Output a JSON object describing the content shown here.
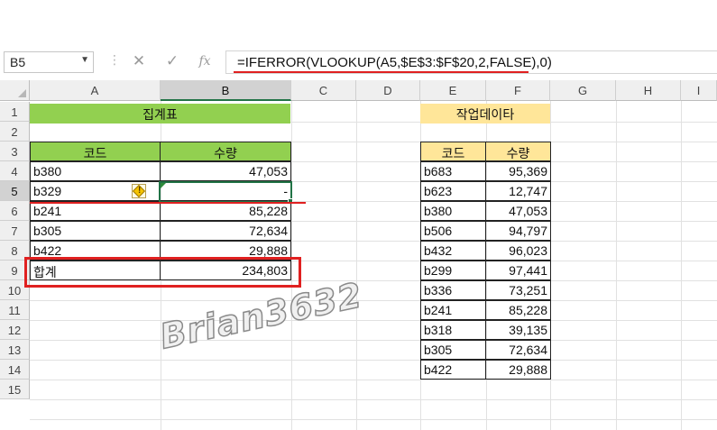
{
  "formula_bar": {
    "name_box": "B5",
    "cancel_icon": "✕",
    "enter_icon": "✓",
    "fx_label": "fx",
    "formula": "=IFERROR(VLOOKUP(A5,$E$3:$F$20,2,FALSE),0)"
  },
  "columns": [
    "A",
    "B",
    "C",
    "D",
    "E",
    "F",
    "G",
    "H",
    "I"
  ],
  "rows": [
    "1",
    "2",
    "3",
    "4",
    "5",
    "6",
    "7",
    "8",
    "9",
    "10",
    "11",
    "12",
    "13",
    "14",
    "15"
  ],
  "summary": {
    "title": "집계표",
    "header_code": "코드",
    "header_qty": "수량",
    "items": [
      {
        "code": "b380",
        "qty": "47,053"
      },
      {
        "code": "b329",
        "qty": "-"
      },
      {
        "code": "b241",
        "qty": "85,228"
      },
      {
        "code": "b305",
        "qty": "72,634"
      },
      {
        "code": "b422",
        "qty": "29,888"
      }
    ],
    "total_label": "합계",
    "total_value": "234,803"
  },
  "work_data": {
    "title": "작업데이타",
    "header_code": "코드",
    "header_qty": "수량",
    "items": [
      {
        "code": "b683",
        "qty": "95,369"
      },
      {
        "code": "b623",
        "qty": "12,747"
      },
      {
        "code": "b380",
        "qty": "47,053"
      },
      {
        "code": "b506",
        "qty": "94,797"
      },
      {
        "code": "b432",
        "qty": "96,023"
      },
      {
        "code": "b299",
        "qty": "97,441"
      },
      {
        "code": "b336",
        "qty": "73,251"
      },
      {
        "code": "b241",
        "qty": "85,228"
      },
      {
        "code": "b318",
        "qty": "39,135"
      },
      {
        "code": "b305",
        "qty": "72,634"
      },
      {
        "code": "b422",
        "qty": "29,888"
      }
    ]
  },
  "watermark": "Brian3632",
  "colors": {
    "green_header": "#92d050",
    "yellow_header": "#ffe699",
    "highlight_red": "#e02020",
    "selection_green": "#217346"
  },
  "icons": {
    "error_indicator": "warning-diamond-icon",
    "name_box_dropdown": "chevron-down-icon"
  }
}
